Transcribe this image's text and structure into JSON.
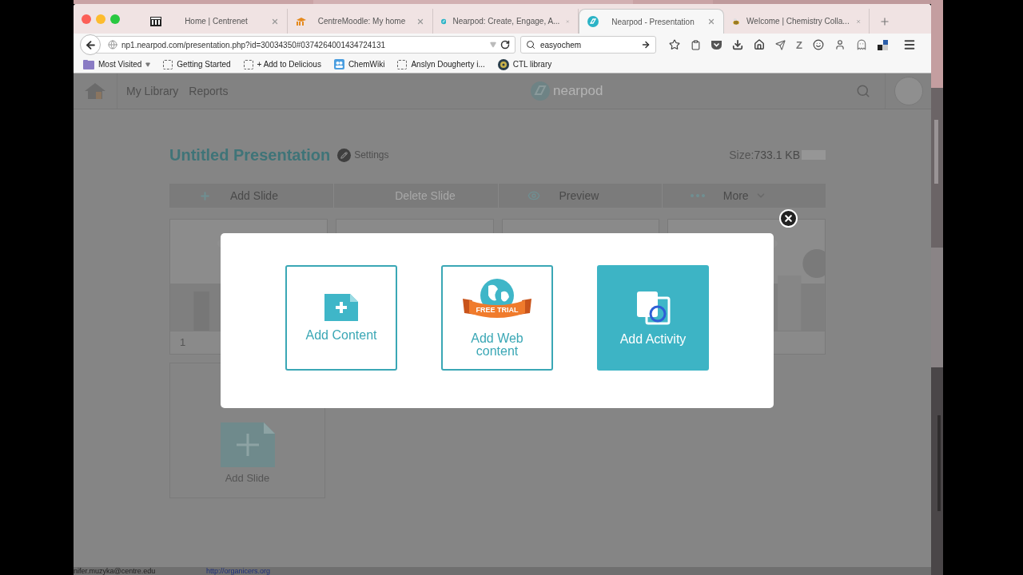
{
  "browser": {
    "tabs": [
      {
        "kind": "building",
        "title": "Home | Centrenet",
        "selected": false
      },
      {
        "kind": "moodle",
        "title": "CentreMoodle: My home",
        "selected": false
      },
      {
        "kind": "nearpod",
        "title": "Nearpod: Create, Engage, A...",
        "selected": false
      },
      {
        "kind": "nearpod",
        "title": "Nearpod - Presentation",
        "selected": true
      },
      {
        "kind": "bee",
        "title": "Welcome | Chemistry Colla...",
        "selected": false
      }
    ],
    "url": "np1.nearpod.com/presentation.php?id=30034350#0374264001434724131",
    "search": {
      "value": "easyochem"
    },
    "extension_label": "Z",
    "bookmarks": [
      {
        "kind": "folder",
        "label": "Most Visited"
      },
      {
        "kind": "page",
        "label": "Getting Started"
      },
      {
        "kind": "page",
        "label": "+ Add to Delicious"
      },
      {
        "kind": "wiki",
        "label": "ChemWiki"
      },
      {
        "kind": "page",
        "label": "Anslyn Dougherty i..."
      },
      {
        "kind": "disc",
        "label": "CTL library"
      }
    ]
  },
  "app": {
    "nav": [
      {
        "label": "My Library"
      },
      {
        "label": "Reports"
      }
    ],
    "logo": "nearpod",
    "title": "Untitled Presentation",
    "settings": "Settings",
    "size_label": "Size:",
    "size_value": "733.1 KB",
    "toolbar": [
      {
        "kind": "add",
        "label": "Add Slide",
        "disabled": false
      },
      {
        "kind": "delete",
        "label": "Delete Slide",
        "disabled": true
      },
      {
        "kind": "preview",
        "label": "Preview",
        "disabled": false
      },
      {
        "kind": "more",
        "label": "More",
        "disabled": false
      }
    ],
    "slides": [
      {
        "kind": "picture",
        "number": "1"
      },
      {
        "kind": "blank"
      },
      {
        "kind": "blank"
      },
      {
        "kind": "picture"
      }
    ],
    "add_slide": "Add Slide"
  },
  "dialog": {
    "options": [
      {
        "kind": "content",
        "label": "Add Content",
        "selected": false
      },
      {
        "kind": "web",
        "label": "Add Web content",
        "badge": "FREE TRIAL",
        "selected": false
      },
      {
        "kind": "activity",
        "label": "Add Activity",
        "selected": true
      }
    ]
  },
  "status_bar": [
    "nifer.muzyka@centre.edu",
    "http://organicers.org"
  ]
}
